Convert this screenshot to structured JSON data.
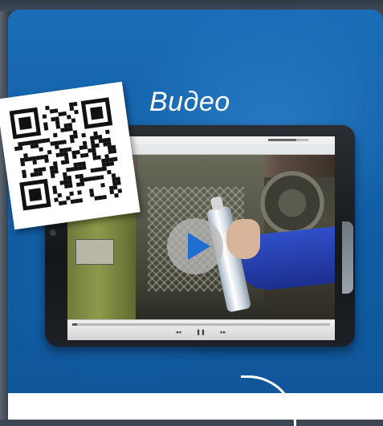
{
  "card": {
    "title": "Видео"
  },
  "player": {
    "status_time": "",
    "play_icon": "play-icon",
    "controls": {
      "prev_label": "◂◂",
      "pause_label": "❚❚",
      "next_label": "▸▸"
    },
    "progress_fraction": 0.02
  },
  "qr_code": {
    "icon": "qr-code-icon"
  },
  "colors": {
    "card_blue": "#1466ae",
    "play_blue": "#1f6fd0",
    "jacket_blue": "#2a45b8"
  }
}
